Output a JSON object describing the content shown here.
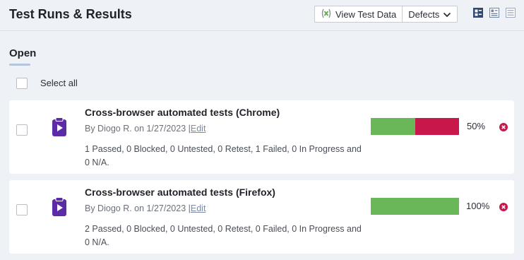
{
  "header": {
    "title": "Test Runs & Results",
    "view_test_data_label": "View Test Data",
    "defects_label": "Defects"
  },
  "section": {
    "title": "Open",
    "select_all_label": "Select all"
  },
  "runs": [
    {
      "title": "Cross-browser automated tests (Chrome)",
      "meta": "By Diogo R. on 1/27/2023",
      "edit_label": "Edit",
      "summary": "1 Passed, 0 Blocked, 0 Untested, 0 Retest, 1 Failed, 0 In Progress and 0 N/A.",
      "passed_fraction": 0.5,
      "failed_fraction": 0.5,
      "percent": "50%"
    },
    {
      "title": "Cross-browser automated tests (Firefox)",
      "meta": "By Diogo R. on 1/27/2023",
      "edit_label": "Edit",
      "summary": "2 Passed, 0 Blocked, 0 Untested, 0 Retest, 0 Failed, 0 In Progress and 0 N/A.",
      "passed_fraction": 1.0,
      "failed_fraction": 0.0,
      "percent": "100%"
    }
  ],
  "icons": [
    "view-test-data-icon",
    "chevron-down-icon",
    "view-mode-compact-icon",
    "view-mode-details-icon",
    "view-mode-list-icon",
    "test-run-icon",
    "close-icon"
  ],
  "colors": {
    "passed": "#6ab759",
    "failed": "#c8174a",
    "icon_purple": "#5b2ca6",
    "close_red": "#c8174a"
  }
}
